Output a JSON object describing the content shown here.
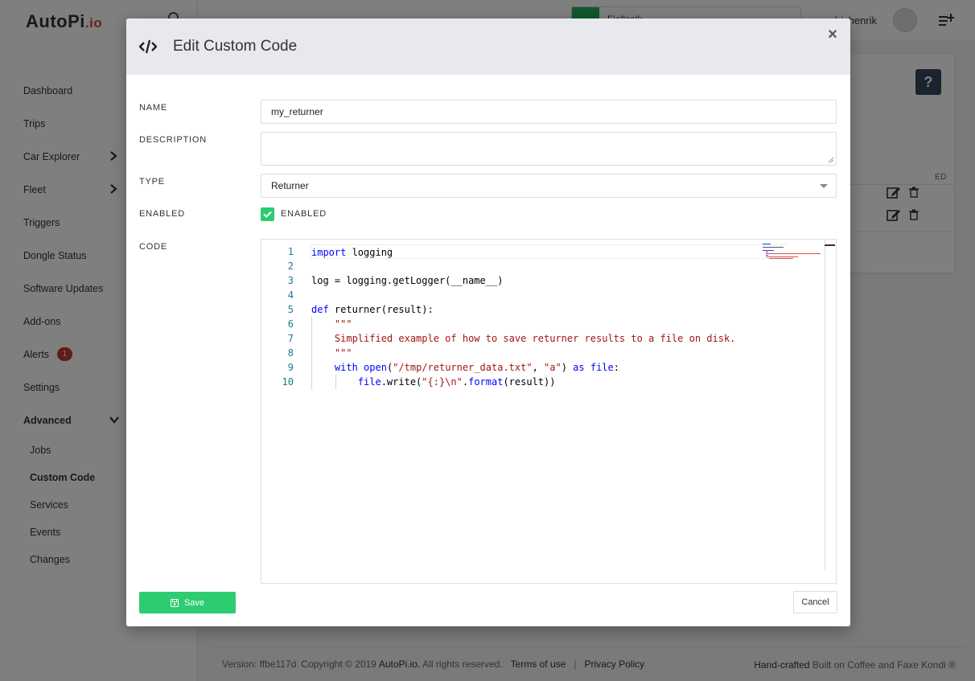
{
  "app": {
    "logo_main": "AutoPi",
    "logo_suffix": ".io",
    "device_name": "Fjollesik",
    "user_name": "hjshenrik"
  },
  "sidebar": {
    "items": [
      {
        "label": "Dashboard"
      },
      {
        "label": "Trips"
      },
      {
        "label": "Car Explorer"
      },
      {
        "label": "Fleet"
      },
      {
        "label": "Triggers"
      },
      {
        "label": "Dongle Status"
      },
      {
        "label": "Software Updates"
      },
      {
        "label": "Add-ons"
      },
      {
        "label": "Alerts",
        "badge": "1"
      },
      {
        "label": "Settings"
      },
      {
        "label": "Advanced"
      }
    ],
    "advanced_items": [
      {
        "label": "Jobs"
      },
      {
        "label": "Custom Code"
      },
      {
        "label": "Services"
      },
      {
        "label": "Events"
      },
      {
        "label": "Changes"
      }
    ]
  },
  "background_card": {
    "help_label": "?",
    "column_header": "ED"
  },
  "footer": {
    "version": "Version: ffbe117d",
    "copyright_prefix": "Copyright © 2019",
    "brand": "AutoPi.io.",
    "rights": "All rights reserved.",
    "terms": "Terms of use",
    "separator": "|",
    "privacy": "Privacy Policy",
    "handcrafted": "Hand-crafted",
    "built_on": "Built on Coffee and Faxe Kondi ®"
  },
  "modal": {
    "title": "Edit Custom Code",
    "close_label": "×",
    "labels": {
      "name": "NAME",
      "description": "DESCRIPTION",
      "type": "TYPE",
      "enabled": "ENABLED",
      "code": "CODE"
    },
    "name_value": "my_returner",
    "description_value": "",
    "type_value": "Returner",
    "enabled_checkbox_label": "ENABLED",
    "enabled": true,
    "code_lines": [
      "import logging",
      "",
      "log = logging.getLogger(__name__)",
      "",
      "def returner(result):",
      "    \"\"\"",
      "    Simplified example of how to save returner results to a file on disk.",
      "    \"\"\"",
      "    with open(\"/tmp/returner_data.txt\", \"a\") as file:",
      "        file.write(\"{:}\\n\".format(result))"
    ],
    "line_numbers": [
      "1",
      "2",
      "3",
      "4",
      "5",
      "6",
      "7",
      "8",
      "9",
      "10"
    ],
    "save_label": "Save",
    "cancel_label": "Cancel"
  },
  "colors": {
    "accent_green": "#2ecc71",
    "alert_badge": "#c0392b",
    "help_button": "#34495e"
  }
}
